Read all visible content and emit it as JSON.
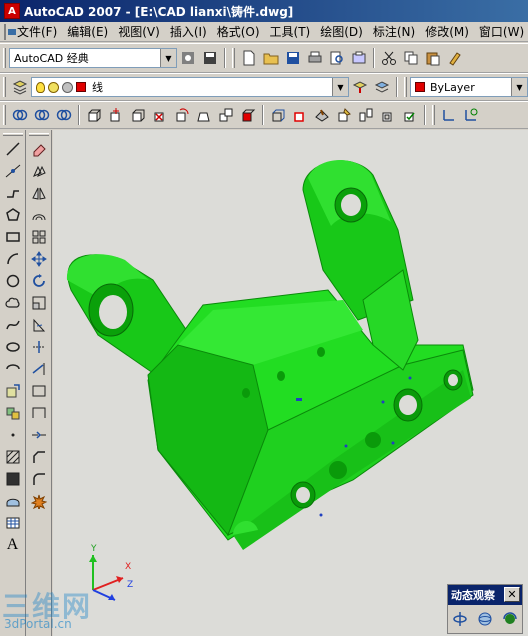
{
  "window": {
    "title": "AutoCAD 2007 - [E:\\CAD lianxi\\铸件.dwg]",
    "app_icon": "A"
  },
  "menu": [
    "文件(F)",
    "编辑(E)",
    "视图(V)",
    "插入(I)",
    "格式(O)",
    "工具(T)",
    "绘图(D)",
    "标注(N)",
    "修改(M)",
    "窗口(W)"
  ],
  "toolbar_workspace": {
    "workspace_value": "AutoCAD 经典"
  },
  "toolbar_layers": {
    "layer_value": "线",
    "color_value": "ByLayer",
    "layer_color": "#e00000"
  },
  "orbit_panel": {
    "title": "动态观察"
  },
  "watermark": {
    "big": "三维网",
    "small": "3dPortal.cn"
  },
  "ucs": {
    "x": "X",
    "y": "Y",
    "z": "Z"
  },
  "colors": {
    "model": "#22dd22",
    "model_dark": "#0c9a0c",
    "background": "#dcdcd8"
  }
}
